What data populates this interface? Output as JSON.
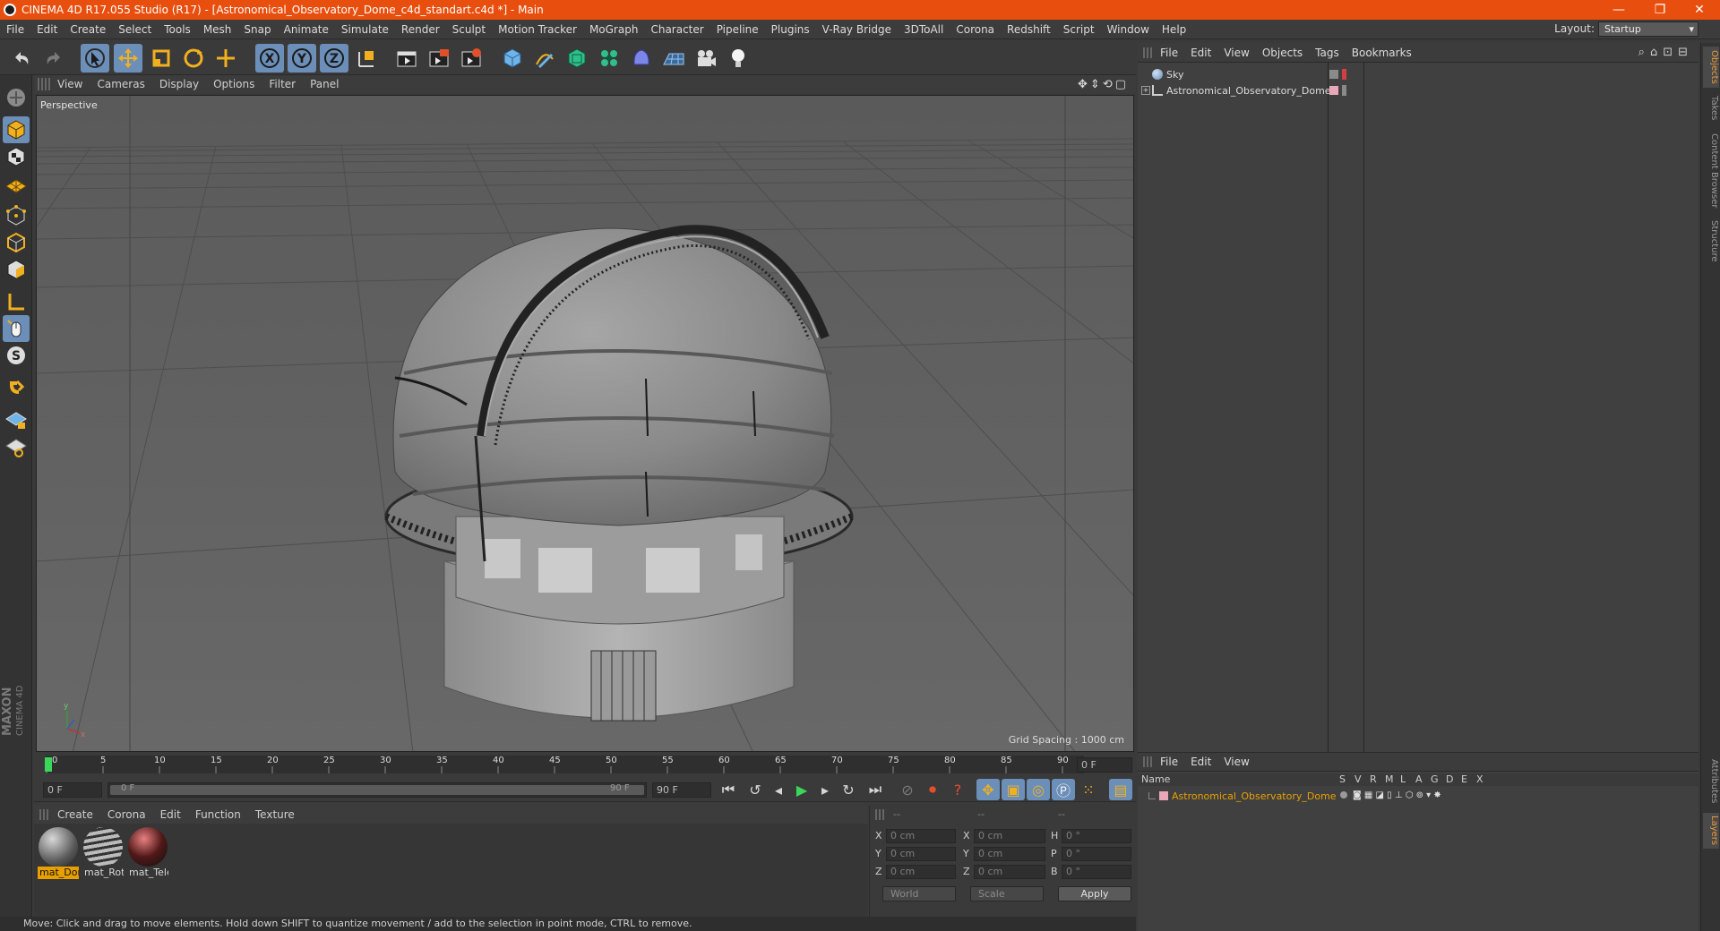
{
  "window": {
    "title": "CINEMA 4D R17.055 Studio (R17) - [Astronomical_Observatory_Dome_c4d_standart.c4d *] - Main",
    "minimize": "—",
    "restore": "❐",
    "close": "✕"
  },
  "menu": [
    "File",
    "Edit",
    "Create",
    "Select",
    "Tools",
    "Mesh",
    "Snap",
    "Animate",
    "Simulate",
    "Render",
    "Sculpt",
    "Motion Tracker",
    "MoGraph",
    "Character",
    "Pipeline",
    "Plugins",
    "V-Ray Bridge",
    "3DToAll",
    "Corona",
    "Redshift",
    "Script",
    "Window",
    "Help"
  ],
  "layout": {
    "label": "Layout:",
    "value": "Startup"
  },
  "toolbar_icons": [
    "undo-icon",
    "redo-icon",
    "live-selection-icon",
    "move-icon",
    "scale-icon",
    "rotate-icon",
    "move-axis-icon",
    "x-axis-icon",
    "y-axis-icon",
    "z-axis-icon",
    "coordinate-system-icon",
    "render-view-icon",
    "render-picture-viewer-icon",
    "edit-render-settings-icon",
    "cube-icon",
    "pen-icon",
    "subdivision-icon",
    "cloner-icon",
    "deformer-icon",
    "floor-icon",
    "camera-icon",
    "light-icon"
  ],
  "viewport": {
    "menu": [
      "View",
      "Cameras",
      "Display",
      "Options",
      "Filter",
      "Panel"
    ],
    "label": "Perspective",
    "grid_spacing": "Grid Spacing : 1000 cm"
  },
  "timeline": {
    "ticks": [
      "0",
      "5",
      "10",
      "15",
      "20",
      "25",
      "30",
      "35",
      "40",
      "45",
      "50",
      "55",
      "60",
      "65",
      "70",
      "75",
      "80",
      "85",
      "90"
    ],
    "current_frame": "0 F",
    "start_frame": "0 F",
    "range_start": "0 F",
    "range_end": "90 F",
    "end_frame": "90 F"
  },
  "materials": {
    "menu": [
      "Create",
      "Corona",
      "Edit",
      "Function",
      "Texture"
    ],
    "items": [
      {
        "name": "mat_Dome"
      },
      {
        "name": "mat_Rotate"
      },
      {
        "name": "mat_Telescope"
      }
    ]
  },
  "coords": {
    "headers": [
      "--",
      "--",
      "--"
    ],
    "rows": [
      {
        "a": "X",
        "av": "0 cm",
        "b": "X",
        "bv": "0 cm",
        "c": "H",
        "cv": "0 °"
      },
      {
        "a": "Y",
        "av": "0 cm",
        "b": "Y",
        "bv": "0 cm",
        "c": "P",
        "cv": "0 °"
      },
      {
        "a": "Z",
        "av": "0 cm",
        "b": "Z",
        "bv": "0 cm",
        "c": "B",
        "cv": "0 °"
      }
    ],
    "space": "World",
    "mode": "Scale",
    "apply": "Apply"
  },
  "status": "Move: Click and drag to move elements. Hold down SHIFT to quantize movement / add to the selection in point mode, CTRL to remove.",
  "objects": {
    "menu": [
      "File",
      "Edit",
      "View",
      "Objects",
      "Tags",
      "Bookmarks"
    ],
    "items": [
      {
        "name": "Sky"
      },
      {
        "name": "Astronomical_Observatory_Dome"
      }
    ]
  },
  "layers": {
    "menu": [
      "File",
      "Edit",
      "View"
    ],
    "head_name": "Name",
    "columns": [
      "S",
      "V",
      "R",
      "M",
      "L",
      "A",
      "G",
      "D",
      "E",
      "X"
    ],
    "items": [
      {
        "name": "Astronomical_Observatory_Dome"
      }
    ]
  },
  "side_tabs": [
    "Objects",
    "Takes",
    "Content Browser",
    "Structure"
  ],
  "side_tabs_bottom": [
    "Attributes",
    "Layers"
  ],
  "brand": {
    "line1": "MAXON",
    "line2": "CINEMA 4D"
  },
  "colors": {
    "titlebar": "#e84f0e",
    "selected_tool": "#6c8fb9",
    "selected_label": "#e8a000",
    "layer_name": "#e8a000"
  }
}
